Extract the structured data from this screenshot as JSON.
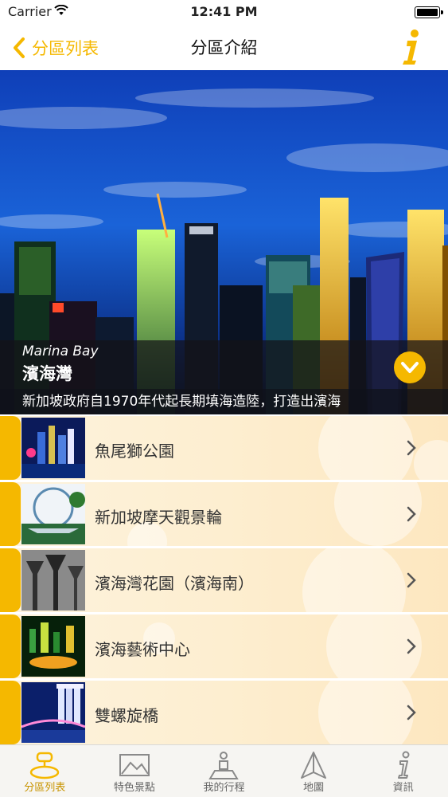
{
  "status_bar": {
    "carrier": "Carrier",
    "time": "12:41 PM"
  },
  "nav": {
    "back_label": "分區列表",
    "title": "分區介紹",
    "info_icon": "info-icon",
    "accent_color": "#f5b800"
  },
  "district": {
    "name_en": "Marina Bay",
    "name_zh": "濱海灣",
    "description": "新加坡政府自1970年代起長期填海造陸，打造出濱海"
  },
  "attractions": [
    {
      "label": "魚尾獅公園"
    },
    {
      "label": "新加坡摩天觀景輪"
    },
    {
      "label": "濱海灣花園（濱海南）"
    },
    {
      "label": "濱海藝術中心"
    },
    {
      "label": "雙螺旋橋"
    }
  ],
  "tabs": [
    {
      "label": "分區列表",
      "icon": "district-list-icon",
      "active": true
    },
    {
      "label": "特色景點",
      "icon": "mountain-icon",
      "active": false
    },
    {
      "label": "我的行程",
      "icon": "itinerary-icon",
      "active": false
    },
    {
      "label": "地圖",
      "icon": "map-icon",
      "active": false
    },
    {
      "label": "資訊",
      "icon": "info-icon",
      "active": false
    }
  ]
}
